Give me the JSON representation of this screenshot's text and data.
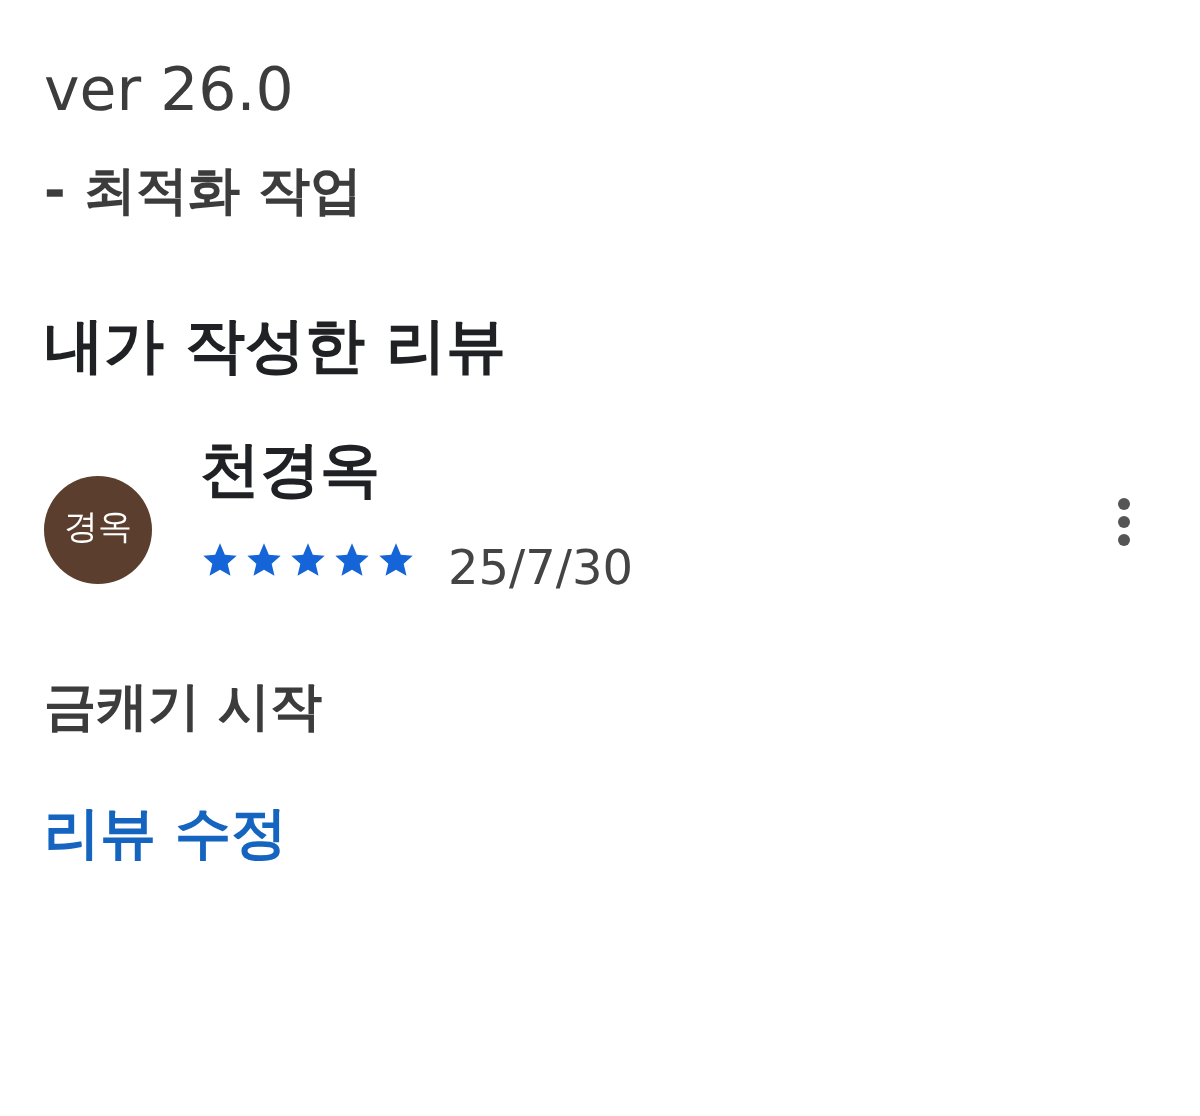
{
  "version": {
    "title": "ver 26.0",
    "note": "- 최적화 작업"
  },
  "reviews_section": {
    "heading": "내가 작성한 리뷰"
  },
  "review": {
    "avatar": "경옥",
    "name": "천경옥",
    "stars": 5,
    "date": "25/7/30",
    "text": "금캐기 시작",
    "edit_link": "리뷰 수정"
  }
}
